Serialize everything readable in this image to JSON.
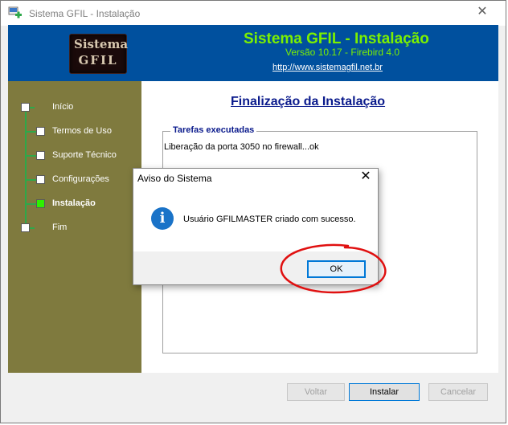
{
  "window": {
    "title": "Sistema GFIL - Instalação"
  },
  "header": {
    "logo_line1": "Sistema",
    "logo_line2": "GFIL",
    "title": "Sistema GFIL - Instalação",
    "version": "Versão 10.17 - Firebird 4.0",
    "url": "http://www.sistemagfil.net.br",
    "accent_color": "#7cf000",
    "background_color": "#00509e"
  },
  "steps": [
    {
      "label": "Início",
      "state": "done"
    },
    {
      "label": "Termos de Uso",
      "state": "done"
    },
    {
      "label": "Suporte Técnico",
      "state": "done"
    },
    {
      "label": "Configurações",
      "state": "done"
    },
    {
      "label": "Instalação",
      "state": "active"
    },
    {
      "label": "Fim",
      "state": "pending"
    }
  ],
  "main": {
    "title": "Finalização da Instalação",
    "group_label": "Tarefas executadas",
    "tasks": [
      "Liberação da porta 3050 no firewall...ok"
    ]
  },
  "buttons": {
    "back": "Voltar",
    "install": "Instalar",
    "cancel": "Cancelar"
  },
  "dialog": {
    "title": "Aviso do Sistema",
    "icon": "info-icon",
    "message": "Usuário GFILMASTER criado com sucesso.",
    "ok": "OK"
  },
  "icons": {
    "window_close": "close-icon",
    "dialog_close": "close-icon",
    "info_glyph": "i"
  }
}
